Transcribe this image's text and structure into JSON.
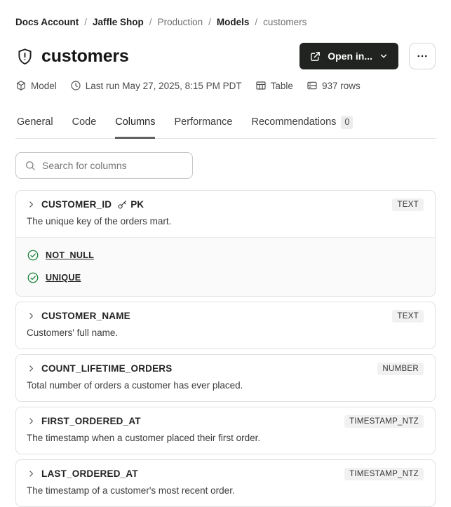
{
  "breadcrumb": {
    "separator": "/",
    "items": [
      {
        "label": "Docs Account",
        "emphasis": true
      },
      {
        "label": "Jaffle Shop",
        "emphasis": true
      },
      {
        "label": "Production",
        "emphasis": false
      },
      {
        "label": "Models",
        "emphasis": true
      },
      {
        "label": "customers",
        "emphasis": false
      }
    ]
  },
  "header": {
    "title": "customers",
    "title_icon": "shield-alert-icon",
    "open_in_label": "Open in...",
    "more_icon": "ellipsis-icon"
  },
  "meta": {
    "items": [
      {
        "icon": "cube-icon",
        "label": "Model"
      },
      {
        "icon": "clock-icon",
        "label": "Last run May 27, 2025, 8:15 PM PDT"
      },
      {
        "icon": "table-icon",
        "label": "Table"
      },
      {
        "icon": "rows-icon",
        "label": "937 rows"
      }
    ]
  },
  "tabs": {
    "items": [
      {
        "label": "General",
        "active": false
      },
      {
        "label": "Code",
        "active": false
      },
      {
        "label": "Columns",
        "active": true
      },
      {
        "label": "Performance",
        "active": false
      },
      {
        "label": "Recommendations",
        "active": false,
        "badge": "0"
      }
    ]
  },
  "search": {
    "placeholder": "Search for columns"
  },
  "columns": [
    {
      "name": "CUSTOMER_ID",
      "primary_key": true,
      "pk_label": "PK",
      "type": "TEXT",
      "description": "The unique key of the orders mart.",
      "tests": [
        "NOT_NULL",
        "UNIQUE"
      ]
    },
    {
      "name": "CUSTOMER_NAME",
      "primary_key": false,
      "type": "TEXT",
      "description": "Customers' full name.",
      "tests": []
    },
    {
      "name": "COUNT_LIFETIME_ORDERS",
      "primary_key": false,
      "type": "NUMBER",
      "description": "Total number of orders a customer has ever placed.",
      "tests": []
    },
    {
      "name": "FIRST_ORDERED_AT",
      "primary_key": false,
      "type": "TIMESTAMP_NTZ",
      "description": "The timestamp when a customer placed their first order.",
      "tests": []
    },
    {
      "name": "LAST_ORDERED_AT",
      "primary_key": false,
      "type": "TIMESTAMP_NTZ",
      "description": "The timestamp of a customer's most recent order.",
      "tests": []
    }
  ],
  "colors": {
    "primary_button_bg": "#20231f",
    "success_green": "#178239",
    "badge_bg": "#f1f1f1",
    "card_border": "#e1e1e1"
  }
}
